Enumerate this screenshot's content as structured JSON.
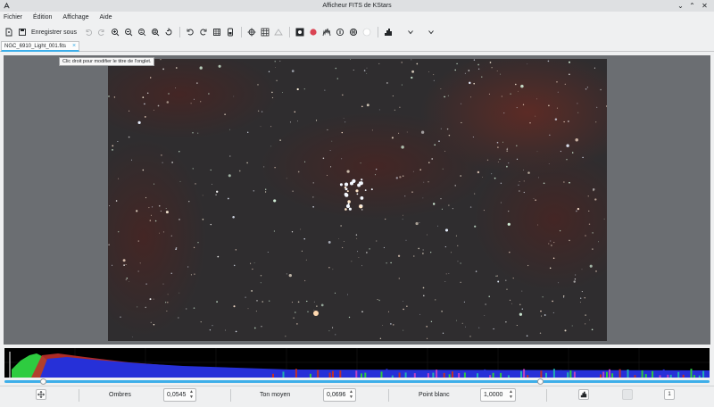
{
  "window": {
    "title": "Afficheur FITS de KStars",
    "controls": {
      "minimize": "⌄",
      "maximize": "⌃",
      "close": "✕"
    }
  },
  "menubar": {
    "items": [
      "Fichier",
      "Édition",
      "Affichage",
      "Aide"
    ]
  },
  "toolbar": {
    "save_as_label": "Enregistrer sous",
    "icons": [
      "open-icon",
      "save-icon",
      "undo-icon",
      "redo-icon",
      "zoom-in-icon",
      "zoom-out-icon",
      "zoom-default-icon",
      "zoom-fit-icon",
      "rotate-icon",
      "rotate-ccw-icon",
      "rotate-cw-icon",
      "statistics-icon",
      "header-icon",
      "crosshair-icon",
      "pixel-grid-icon",
      "eq-grid-icon",
      "stretch-icon",
      "mark-stars-icon",
      "star-profile-icon",
      "objects-icon",
      "globe-icon",
      "highlight-icon",
      "histogram-icon",
      "more-icon"
    ]
  },
  "tabs": [
    {
      "label": "NGC_6910_Light_001.fits",
      "close": "×"
    }
  ],
  "tooltip": "Clic droit pour modifier le titre de l'onglet.",
  "stretch": {
    "shadows_label": "Ombres",
    "shadows_value": "0,0545",
    "midtones_label": "Ton moyen",
    "midtones_value": "0,0696",
    "highlights_label": "Point blanc",
    "highlights_value": "1,0000",
    "sampling_value": "1",
    "slider_low_fraction": 0.0545,
    "slider_high_fraction": 0.76
  },
  "colors": {
    "accent": "#3daee9",
    "histogram_red": "#c0302a",
    "histogram_green": "#2ecc40",
    "histogram_blue": "#2630d8",
    "nebula": "#5a2a24"
  }
}
